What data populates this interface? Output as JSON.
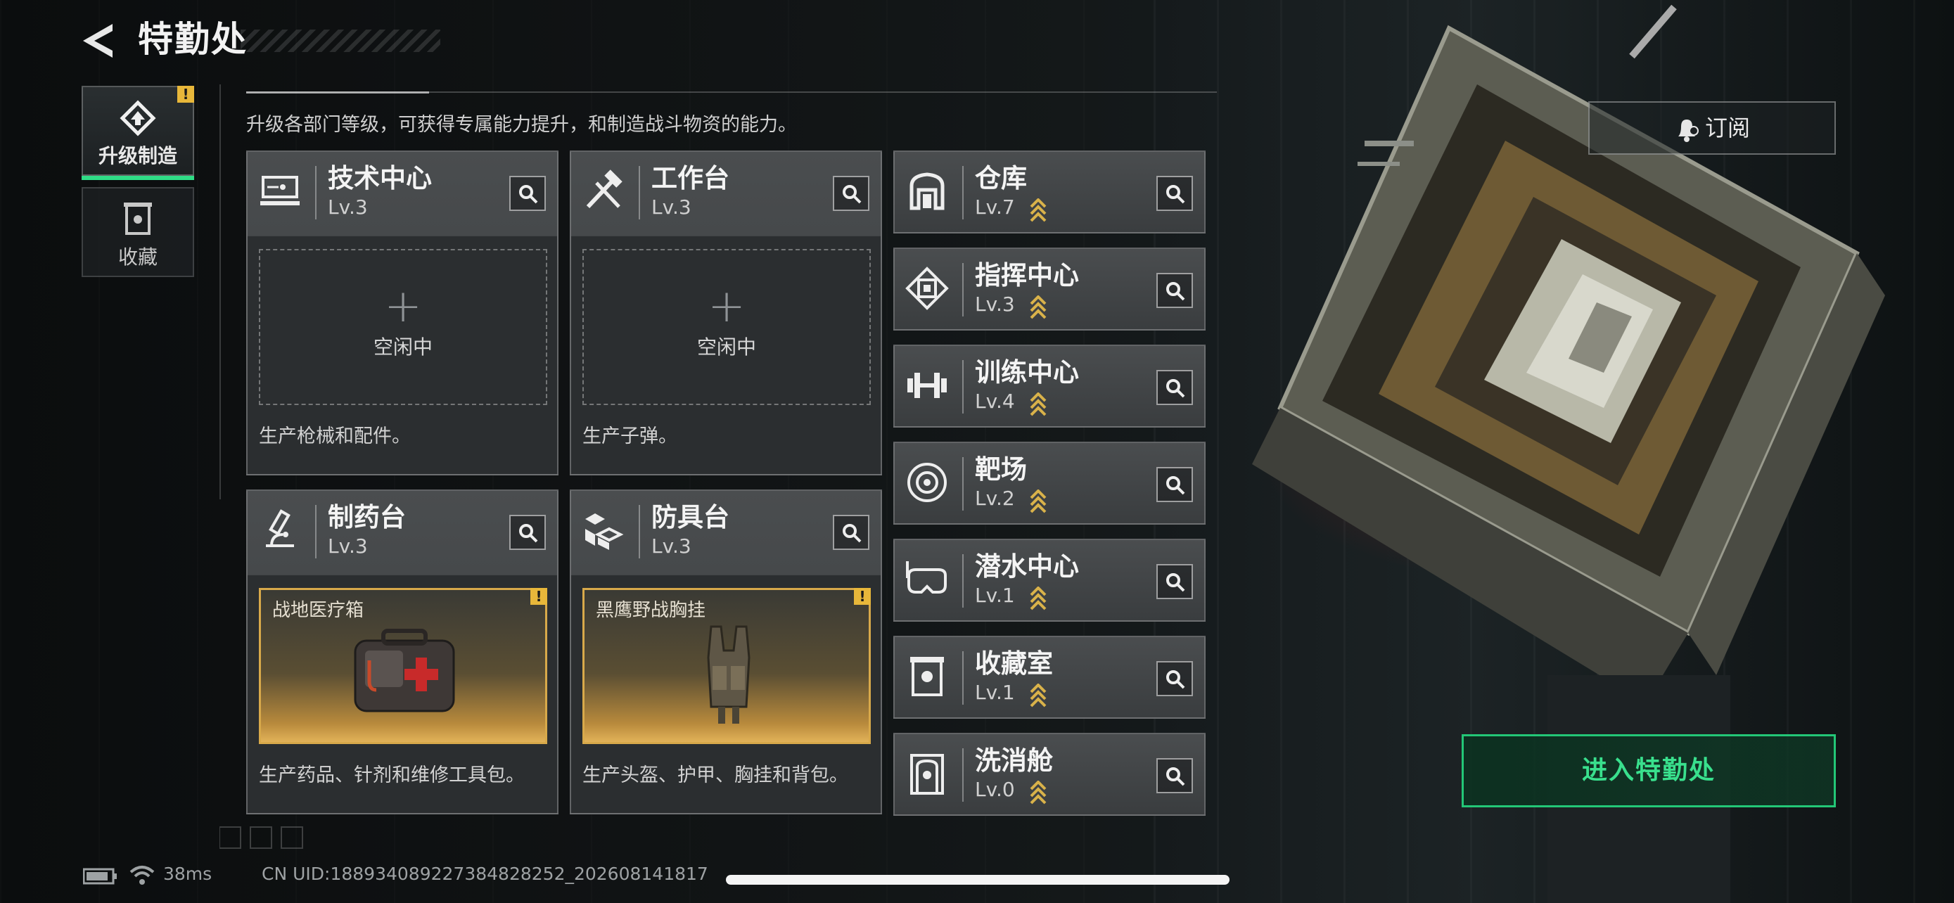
{
  "header": {
    "title": "特勤处",
    "subtitle": "升级各部门等级，可获得专属能力提升，和制造战斗物资的能力。"
  },
  "sidebar": {
    "tabs": [
      {
        "label": "升级制造",
        "icon": "upgrade-icon",
        "active": true,
        "badge": "!"
      },
      {
        "label": "收藏",
        "icon": "collection-icon",
        "active": false
      }
    ]
  },
  "workshops": [
    {
      "name": "技术中心",
      "level": "Lv.3",
      "icon": "tech-center-icon",
      "slot": {
        "type": "empty",
        "label": "空闲中"
      },
      "desc": "生产枪械和配件。"
    },
    {
      "name": "工作台",
      "level": "Lv.3",
      "icon": "workbench-icon",
      "slot": {
        "type": "empty",
        "label": "空闲中"
      },
      "desc": "生产子弹。"
    },
    {
      "name": "制药台",
      "level": "Lv.3",
      "icon": "pharmacy-icon",
      "slot": {
        "type": "item",
        "label": "战地医疗箱",
        "badge": "!"
      },
      "desc": "生产药品、针剂和维修工具包。"
    },
    {
      "name": "防具台",
      "level": "Lv.3",
      "icon": "armor-bench-icon",
      "slot": {
        "type": "item",
        "label": "黑鹰野战胸挂",
        "badge": "!"
      },
      "desc": "生产头盔、护甲、胸挂和背包。"
    }
  ],
  "departments": [
    {
      "name": "仓库",
      "level": "Lv.7",
      "icon": "warehouse-icon",
      "upgradeable": true
    },
    {
      "name": "指挥中心",
      "level": "Lv.3",
      "icon": "command-center-icon",
      "upgradeable": true
    },
    {
      "name": "训练中心",
      "level": "Lv.4",
      "icon": "training-center-icon",
      "upgradeable": true
    },
    {
      "name": "靶场",
      "level": "Lv.2",
      "icon": "shooting-range-icon",
      "upgradeable": true
    },
    {
      "name": "潜水中心",
      "level": "Lv.1",
      "icon": "diving-center-icon",
      "upgradeable": true
    },
    {
      "name": "收藏室",
      "level": "Lv.1",
      "icon": "collection-room-icon",
      "upgradeable": true
    },
    {
      "name": "洗消舱",
      "level": "Lv.0",
      "icon": "decon-chamber-icon",
      "upgradeable": true
    }
  ],
  "actions": {
    "subscribe_label": "订阅",
    "enter_label": "进入特勤处"
  },
  "status_bar": {
    "ping": "38ms",
    "uid": "CN UID:18893408922​7384828252_202608141817"
  },
  "colors": {
    "accent_green": "#2fdc86",
    "badge_gold": "#e8b73a",
    "item_gold": "#d8a94a"
  }
}
